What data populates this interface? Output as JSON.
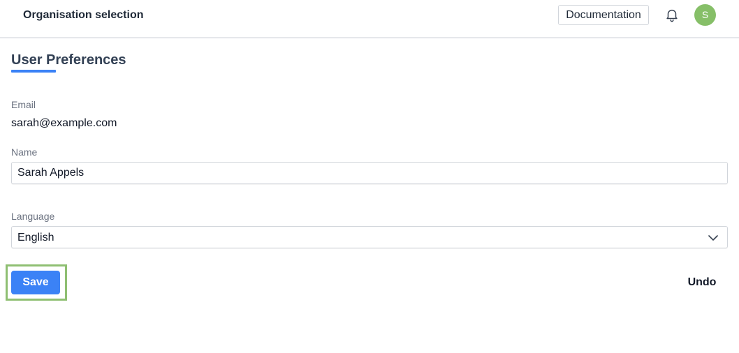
{
  "header": {
    "org_selection": "Organisation selection",
    "documentation_label": "Documentation",
    "notification_icon": "bell-icon",
    "avatar_initial": "S",
    "avatar_color": "#86bf68"
  },
  "page": {
    "title": "User Preferences",
    "accent_color": "#3b82f6"
  },
  "form": {
    "email_label": "Email",
    "email_value": "sarah@example.com",
    "name_label": "Name",
    "name_value": "Sarah Appels",
    "language_label": "Language",
    "language_value": "English",
    "language_icon": "chevron-down-icon"
  },
  "actions": {
    "save_label": "Save",
    "undo_label": "Undo",
    "highlight_color": "#8fbf72"
  }
}
